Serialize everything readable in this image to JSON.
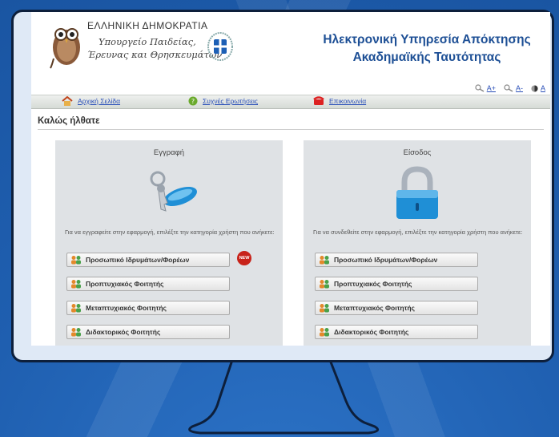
{
  "header": {
    "ministry_line1": "ΕΛΛΗΝΙΚΗ ΔΗΜΟΚΡΑΤΙΑ",
    "ministry_line2": "Υπουργείο Παιδείας,",
    "ministry_line3": "Έρευνας και Θρησκευμάτων",
    "title_line1": "Ηλεκτρονική Υπηρεσία Απόκτησης",
    "title_line2": "Ακαδημαϊκής Ταυτότητας",
    "font_controls": [
      "A+",
      "A-",
      "A"
    ]
  },
  "nav": {
    "items": [
      {
        "label": "Αρχική Σελίδα",
        "icon": "home-icon"
      },
      {
        "label": "Συχνές Ερωτήσεις",
        "icon": "help-icon"
      },
      {
        "label": "Επικοινωνία",
        "icon": "phone-icon"
      }
    ]
  },
  "welcome": "Καλώς ήλθατε",
  "register": {
    "title": "Εγγραφή",
    "description": "Για να εγγραφείτε στην εφαρμογή, επιλέξτε την κατηγορία χρήστη που ανήκετε:",
    "buttons": [
      "Προσωπικό Ιδρυμάτων/Φορέων",
      "Προπτυχιακός Φοιτητής",
      "Μεταπτυχιακός Φοιτητής",
      "Διδακτορικός Φοιτητής"
    ],
    "new_badge": "NEW"
  },
  "login": {
    "title": "Είσοδος",
    "description": "Για να συνδεθείτε στην εφαρμογή, επιλέξτε την κατηγορία χρήστη που ανήκετε:",
    "buttons": [
      "Προσωπικό Ιδρυμάτων/Φορέων",
      "Προπτυχιακός Φοιτητής",
      "Μεταπτυχιακός Φοιτητής",
      "Διδακτορικός Φοιτητής"
    ]
  },
  "colors": {
    "background": "#1f5fb0",
    "title_blue": "#1d4f95",
    "link_blue": "#2a4fb8",
    "panel_gray": "#dfe2e5",
    "badge_red": "#c8231a"
  }
}
